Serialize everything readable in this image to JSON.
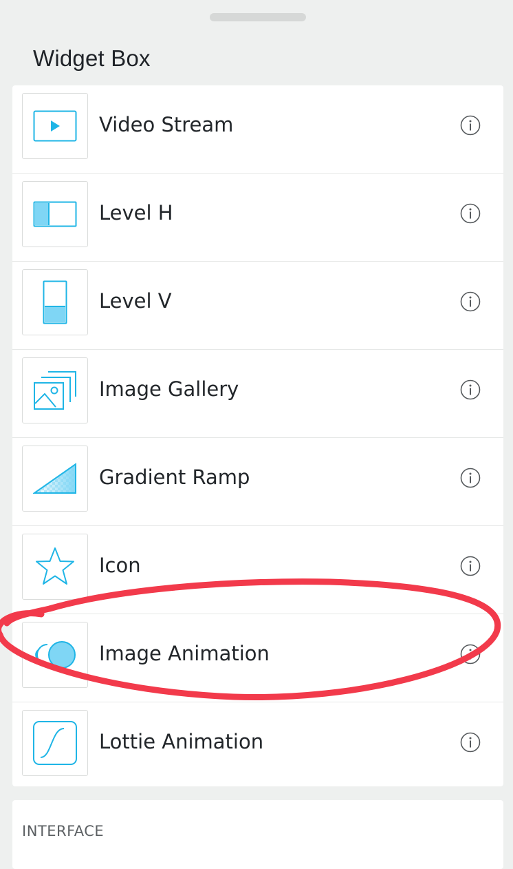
{
  "sheet": {
    "title": "Widget Box"
  },
  "widgets": [
    {
      "label": "Video Stream",
      "icon": "video-stream-icon"
    },
    {
      "label": "Level H",
      "icon": "level-h-icon"
    },
    {
      "label": "Level V",
      "icon": "level-v-icon"
    },
    {
      "label": "Image Gallery",
      "icon": "image-gallery-icon"
    },
    {
      "label": "Gradient Ramp",
      "icon": "gradient-ramp-icon"
    },
    {
      "label": "Icon",
      "icon": "star-icon"
    },
    {
      "label": "Image Animation",
      "icon": "image-animation-icon"
    },
    {
      "label": "Lottie Animation",
      "icon": "lottie-animation-icon"
    }
  ],
  "next_section": {
    "label": "INTERFACE"
  },
  "colors": {
    "accent": "#1fb5e6",
    "accent_fill": "#7fd6f5",
    "annotation": "#f23a4b"
  }
}
